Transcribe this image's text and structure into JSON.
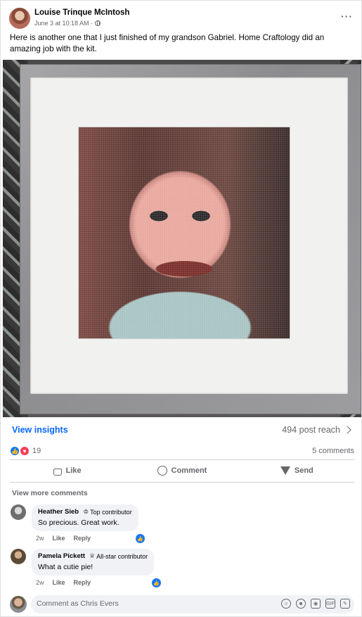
{
  "post": {
    "author": "Louise Trinque McIntosh",
    "time": "June 3 at 10:18 AM ·",
    "audience_icon": "globe-icon",
    "menu": "···",
    "text": "Here is another one that I just finished of my grandson Gabriel. Home Craftology did an amazing job with the kit."
  },
  "insights": {
    "label": "View insights",
    "reach": "494 post reach"
  },
  "reactions": {
    "icons": [
      "like-reaction-icon",
      "love-reaction-icon"
    ],
    "count": "19",
    "comments": "5 comments"
  },
  "actions": {
    "like": "Like",
    "comment": "Comment",
    "send": "Send"
  },
  "comments_section": {
    "view_more": "View more comments",
    "items": [
      {
        "name": "Heather Sieb",
        "badge": "Top contributor",
        "text": "So precious. Great work.",
        "age": "2w",
        "like": "Like",
        "reply": "Reply"
      },
      {
        "name": "Pamela Pickett",
        "badge": "All-star contributor",
        "text": "What a cutie pie!",
        "age": "2w",
        "like": "Like",
        "reply": "Reply"
      }
    ]
  },
  "composer": {
    "placeholder": "Comment as Chris Evers",
    "icons": [
      "avatar-sticker-icon",
      "emoji-icon",
      "camera-icon",
      "gif-icon",
      "sticker-icon"
    ]
  },
  "colors": {
    "accent": "#0866ff",
    "like_blue": "#1877f2",
    "love_red": "#f33e58",
    "secondary_text": "#65676b",
    "bubble_bg": "#f0f2f5"
  }
}
